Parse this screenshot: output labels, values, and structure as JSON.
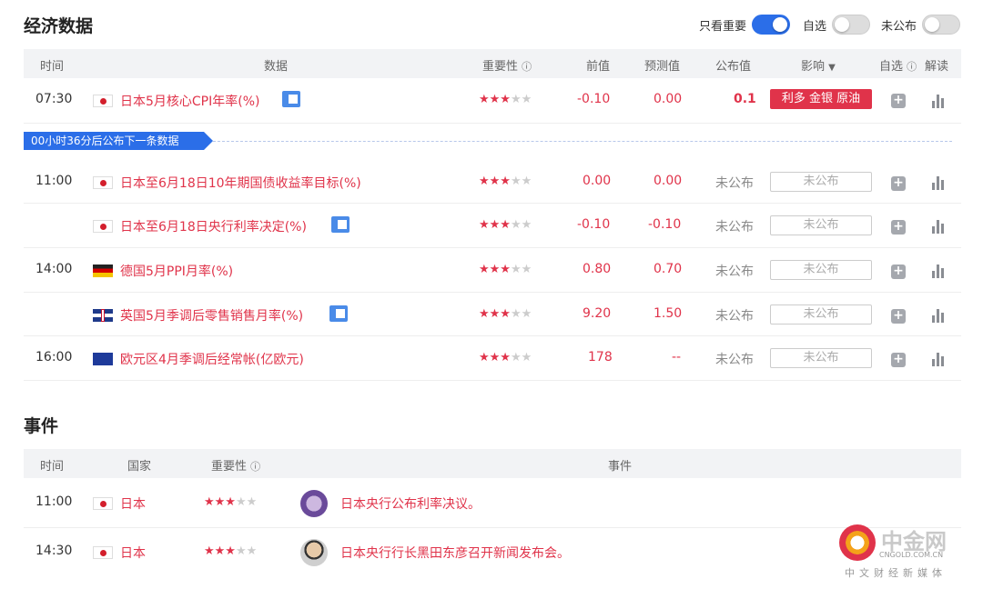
{
  "econ": {
    "title": "经济数据",
    "toggles": [
      {
        "label": "只看重要",
        "on": true
      },
      {
        "label": "自选",
        "on": false
      },
      {
        "label": "未公布",
        "on": false
      }
    ],
    "headers": {
      "time": "时间",
      "data": "数据",
      "importance": "重要性",
      "prev": "前值",
      "forecast": "预测值",
      "actual": "公布值",
      "impact": "影响",
      "watch": "自选",
      "analysis": "解读"
    },
    "banner": "00小时36分后公布下一条数据",
    "rows": [
      {
        "time": "07:30",
        "flag": "jp",
        "name": "日本5月核心CPI年率(%)",
        "stars": 3,
        "prev": "-0.10",
        "forecast": "0.00",
        "actual": "0.1",
        "impact": "利多 金银 原油",
        "doc": true
      },
      {
        "time": "11:00",
        "flag": "jp",
        "name": "日本至6月18日10年期国债收益率目标(%)",
        "stars": 3,
        "prev": "0.00",
        "forecast": "0.00",
        "actual": "未公布",
        "impact": "未公布",
        "doc": false
      },
      {
        "time": "",
        "flag": "jp",
        "name": "日本至6月18日央行利率决定(%)",
        "stars": 3,
        "prev": "-0.10",
        "forecast": "-0.10",
        "actual": "未公布",
        "impact": "未公布",
        "doc": true
      },
      {
        "time": "14:00",
        "flag": "de",
        "name": "德国5月PPI月率(%)",
        "stars": 3,
        "prev": "0.80",
        "forecast": "0.70",
        "actual": "未公布",
        "impact": "未公布",
        "doc": false
      },
      {
        "time": "",
        "flag": "gb",
        "name": "英国5月季调后零售销售月率(%)",
        "stars": 3,
        "prev": "9.20",
        "forecast": "1.50",
        "actual": "未公布",
        "impact": "未公布",
        "doc": true
      },
      {
        "time": "16:00",
        "flag": "eu",
        "name": "欧元区4月季调后经常帐(亿欧元)",
        "stars": 3,
        "prev": "178",
        "forecast": "--",
        "actual": "未公布",
        "impact": "未公布",
        "doc": false
      }
    ]
  },
  "events": {
    "title": "事件",
    "headers": {
      "time": "时间",
      "country": "国家",
      "importance": "重要性",
      "event": "事件"
    },
    "rows": [
      {
        "time": "11:00",
        "flag": "jp",
        "country": "日本",
        "stars": 3,
        "avatar": "seal-icon",
        "event": "日本央行公布利率决议。"
      },
      {
        "time": "14:30",
        "flag": "jp",
        "country": "日本",
        "stars": 3,
        "avatar": "person-avatar",
        "event": "日本央行行长黑田东彦召开新闻发布会。"
      }
    ]
  },
  "watermark": {
    "brand": "中金网",
    "site": "CNGOLD.COM.CN",
    "tagline": "中文财经新媒体"
  },
  "colors": {
    "accent": "#2b6ee8",
    "red": "#e0334a"
  }
}
